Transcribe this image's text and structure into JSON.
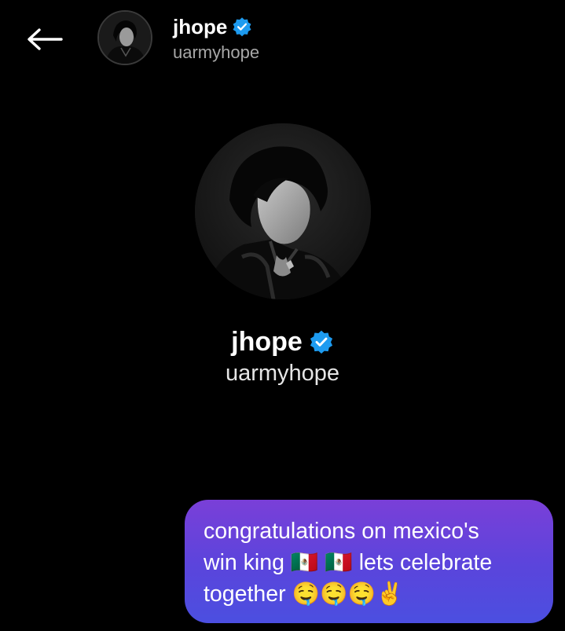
{
  "header": {
    "back_icon": "arrow-left-icon",
    "name": "jhope",
    "handle": "uarmyhope",
    "verified_icon": "verified-badge-icon",
    "verified_color": "#1d9bf0"
  },
  "profile": {
    "name": "jhope",
    "handle": "uarmyhope",
    "verified_icon": "verified-badge-icon"
  },
  "message": {
    "text": "congratulations on mexico's\nwin king 🇲🇽 🇲🇽 lets celebrate\ntogether 🤤🤤🤤✌️",
    "bubble_color_top": "#7a3fd8",
    "bubble_color_bottom": "#4b4fe0"
  }
}
